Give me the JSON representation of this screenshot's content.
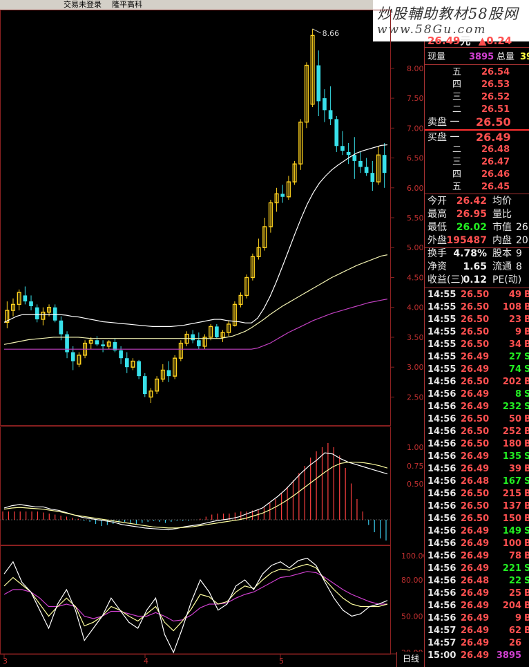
{
  "window": {
    "login_status": "交易未登录",
    "stock_name": "隆平高科"
  },
  "watermark": {
    "line1": "炒股輔助教材58股网",
    "line2": "www.58Gu.com"
  },
  "quote_header": {
    "price": "26.49",
    "unit": "元",
    "change": "▲0.24",
    "extra": "0"
  },
  "volume_row": {
    "now_label": "现量",
    "now_value": "3895",
    "total_label": "总量",
    "total_value": "39"
  },
  "sell_orders": [
    {
      "label": "五",
      "price": "26.54"
    },
    {
      "label": "四",
      "price": "26.53"
    },
    {
      "label": "三",
      "price": "26.52"
    },
    {
      "label": "二",
      "price": "26.51"
    },
    {
      "label": "卖盘 一",
      "price": "26.50"
    }
  ],
  "buy_orders": [
    {
      "label": "买盘 一",
      "price": "26.49"
    },
    {
      "label": "二",
      "price": "26.48"
    },
    {
      "label": "三",
      "price": "26.47"
    },
    {
      "label": "四",
      "price": "26.46"
    },
    {
      "label": "五",
      "price": "26.45"
    }
  ],
  "stats": [
    {
      "l1": "今开",
      "v1": "26.42",
      "c1": "red",
      "l2": "均价",
      "v2": ""
    },
    {
      "l1": "最高",
      "v1": "26.95",
      "c1": "red",
      "l2": "量比",
      "v2": ""
    },
    {
      "l1": "最低",
      "v1": "26.02",
      "c1": "grn",
      "l2": "市值",
      "v2": "26"
    },
    {
      "l1": "外盘",
      "v1": "195487",
      "c1": "red",
      "l2": "内盘",
      "v2": "20"
    },
    {
      "l1": "换手",
      "v1": "4.78%",
      "c1": "white",
      "l2": "股本",
      "v2": "9"
    },
    {
      "l1": "净资",
      "v1": "1.65",
      "c1": "white",
      "l2": "流通",
      "v2": "8"
    },
    {
      "l1": "收益(三)",
      "v1": "0.12",
      "c1": "white",
      "l2": "PE(动)",
      "v2": ""
    }
  ],
  "ticks": [
    {
      "t": "14:55",
      "p": "26.50",
      "v": "49",
      "s": "B"
    },
    {
      "t": "14:55",
      "p": "26.50",
      "v": "108",
      "s": "B"
    },
    {
      "t": "14:55",
      "p": "26.50",
      "v": "23",
      "s": "B"
    },
    {
      "t": "14:55",
      "p": "26.50",
      "v": "9",
      "s": "B"
    },
    {
      "t": "14:55",
      "p": "26.50",
      "v": "34",
      "s": "B"
    },
    {
      "t": "14:55",
      "p": "26.49",
      "v": "27",
      "s": "S"
    },
    {
      "t": "14:55",
      "p": "26.49",
      "v": "74",
      "s": "S"
    },
    {
      "t": "14:56",
      "p": "26.50",
      "v": "202",
      "s": "B"
    },
    {
      "t": "14:56",
      "p": "26.49",
      "v": "8",
      "s": "S"
    },
    {
      "t": "14:56",
      "p": "26.49",
      "v": "232",
      "s": "S"
    },
    {
      "t": "14:56",
      "p": "26.50",
      "v": "50",
      "s": "B"
    },
    {
      "t": "14:56",
      "p": "26.50",
      "v": "252",
      "s": "B"
    },
    {
      "t": "14:56",
      "p": "26.50",
      "v": "180",
      "s": "B"
    },
    {
      "t": "14:56",
      "p": "26.49",
      "v": "135",
      "s": "S"
    },
    {
      "t": "14:56",
      "p": "26.49",
      "v": "39",
      "s": "B"
    },
    {
      "t": "14:56",
      "p": "26.48",
      "v": "167",
      "s": "S"
    },
    {
      "t": "14:56",
      "p": "26.50",
      "v": "215",
      "s": "B"
    },
    {
      "t": "14:56",
      "p": "26.50",
      "v": "137",
      "s": "B"
    },
    {
      "t": "14:56",
      "p": "26.50",
      "v": "150",
      "s": "B"
    },
    {
      "t": "14:56",
      "p": "26.49",
      "v": "149",
      "s": "S"
    },
    {
      "t": "14:56",
      "p": "26.49",
      "v": "100",
      "s": "B"
    },
    {
      "t": "14:56",
      "p": "26.49",
      "v": "78",
      "s": "B"
    },
    {
      "t": "14:56",
      "p": "26.49",
      "v": "221",
      "s": "S"
    },
    {
      "t": "14:56",
      "p": "26.48",
      "v": "22",
      "s": "S"
    },
    {
      "t": "14:56",
      "p": "26.49",
      "v": "25",
      "s": "B"
    },
    {
      "t": "14:56",
      "p": "26.49",
      "v": "204",
      "s": "B"
    },
    {
      "t": "14:56",
      "p": "26.49",
      "v": "9",
      "s": "B"
    },
    {
      "t": "14:57",
      "p": "26.49",
      "v": "62",
      "s": "B"
    },
    {
      "t": "14:57",
      "p": "26.49",
      "v": "26",
      "s": ""
    },
    {
      "t": "15:00",
      "p": "26.49",
      "v": "3895",
      "s": ""
    }
  ],
  "chart": {
    "price_axis": [
      "8.00",
      "7.50",
      "7.00",
      "6.50",
      "6.00",
      "5.50",
      "5.00",
      "4.50",
      "4.00",
      "3.50",
      "3.00",
      "2.50"
    ],
    "macd_axis": [
      "1.00",
      "0.75",
      "0.50"
    ],
    "kdj_axis": [
      "100.00",
      "80.00",
      "50.00",
      "20.00"
    ],
    "high_label": "8.66",
    "x_labels": [
      "3",
      "4",
      "5"
    ],
    "period_tab": "日线",
    "colors": {
      "up": "#ffd21e",
      "down": "#38e0ea",
      "ma_long": "#c040c0",
      "ma_mid": "#f0f0b0",
      "ma_short": "#ffffff"
    }
  },
  "chart_data": {
    "type": "candlestick",
    "ylim": [
      2.1,
      8.75
    ],
    "high": 8.66,
    "candles": [
      {
        "o": 3.75,
        "h": 4.1,
        "l": 3.65,
        "c": 3.95
      },
      {
        "o": 3.95,
        "h": 4.15,
        "l": 3.85,
        "c": 4.05
      },
      {
        "o": 4.05,
        "h": 4.3,
        "l": 3.95,
        "c": 4.25
      },
      {
        "o": 4.2,
        "h": 4.35,
        "l": 4.05,
        "c": 4.1
      },
      {
        "o": 4.1,
        "h": 4.2,
        "l": 3.95,
        "c": 4.02
      },
      {
        "o": 4.0,
        "h": 4.05,
        "l": 3.75,
        "c": 3.8
      },
      {
        "o": 3.8,
        "h": 4.0,
        "l": 3.7,
        "c": 3.92
      },
      {
        "o": 3.92,
        "h": 4.05,
        "l": 3.85,
        "c": 4.0
      },
      {
        "o": 4.0,
        "h": 4.05,
        "l": 3.75,
        "c": 3.78
      },
      {
        "o": 3.78,
        "h": 3.85,
        "l": 3.45,
        "c": 3.55
      },
      {
        "o": 3.55,
        "h": 3.6,
        "l": 3.15,
        "c": 3.25
      },
      {
        "o": 3.25,
        "h": 3.35,
        "l": 2.95,
        "c": 3.1
      },
      {
        "o": 3.05,
        "h": 3.25,
        "l": 3.0,
        "c": 3.2
      },
      {
        "o": 3.2,
        "h": 3.45,
        "l": 3.15,
        "c": 3.4
      },
      {
        "o": 3.4,
        "h": 3.5,
        "l": 3.3,
        "c": 3.45
      },
      {
        "o": 3.45,
        "h": 3.52,
        "l": 3.35,
        "c": 3.38
      },
      {
        "o": 3.38,
        "h": 3.45,
        "l": 3.25,
        "c": 3.35
      },
      {
        "o": 3.35,
        "h": 3.45,
        "l": 3.3,
        "c": 3.42
      },
      {
        "o": 3.42,
        "h": 3.48,
        "l": 3.25,
        "c": 3.28
      },
      {
        "o": 3.28,
        "h": 3.35,
        "l": 3.05,
        "c": 3.15
      },
      {
        "o": 3.15,
        "h": 3.25,
        "l": 2.9,
        "c": 3.0
      },
      {
        "o": 3.0,
        "h": 3.15,
        "l": 2.95,
        "c": 3.1
      },
      {
        "o": 3.1,
        "h": 3.12,
        "l": 2.8,
        "c": 2.85
      },
      {
        "o": 2.85,
        "h": 2.9,
        "l": 2.5,
        "c": 2.55
      },
      {
        "o": 2.5,
        "h": 2.65,
        "l": 2.4,
        "c": 2.6
      },
      {
        "o": 2.6,
        "h": 2.85,
        "l": 2.55,
        "c": 2.8
      },
      {
        "o": 2.8,
        "h": 3.05,
        "l": 2.75,
        "c": 2.95
      },
      {
        "o": 2.95,
        "h": 3.1,
        "l": 2.75,
        "c": 2.85
      },
      {
        "o": 2.85,
        "h": 3.2,
        "l": 2.8,
        "c": 3.15
      },
      {
        "o": 3.15,
        "h": 3.45,
        "l": 3.1,
        "c": 3.4
      },
      {
        "o": 3.4,
        "h": 3.6,
        "l": 3.35,
        "c": 3.55
      },
      {
        "o": 3.55,
        "h": 3.62,
        "l": 3.4,
        "c": 3.45
      },
      {
        "o": 3.45,
        "h": 3.58,
        "l": 3.3,
        "c": 3.35
      },
      {
        "o": 3.35,
        "h": 3.55,
        "l": 3.3,
        "c": 3.5
      },
      {
        "o": 3.5,
        "h": 3.72,
        "l": 3.45,
        "c": 3.68
      },
      {
        "o": 3.68,
        "h": 3.72,
        "l": 3.48,
        "c": 3.5
      },
      {
        "o": 3.5,
        "h": 3.62,
        "l": 3.42,
        "c": 3.58
      },
      {
        "o": 3.58,
        "h": 3.78,
        "l": 3.52,
        "c": 3.72
      },
      {
        "o": 3.7,
        "h": 4.1,
        "l": 3.68,
        "c": 4.05
      },
      {
        "o": 4.05,
        "h": 4.25,
        "l": 4.0,
        "c": 4.2
      },
      {
        "o": 4.2,
        "h": 4.55,
        "l": 4.15,
        "c": 4.5
      },
      {
        "o": 4.5,
        "h": 4.9,
        "l": 4.45,
        "c": 4.85
      },
      {
        "o": 4.85,
        "h": 5.15,
        "l": 4.8,
        "c": 5.0
      },
      {
        "o": 5.0,
        "h": 5.5,
        "l": 4.95,
        "c": 5.35
      },
      {
        "o": 5.35,
        "h": 5.8,
        "l": 5.25,
        "c": 5.75
      },
      {
        "o": 5.75,
        "h": 6.0,
        "l": 5.6,
        "c": 5.9
      },
      {
        "o": 5.9,
        "h": 6.05,
        "l": 5.75,
        "c": 5.85
      },
      {
        "o": 5.85,
        "h": 6.2,
        "l": 5.8,
        "c": 6.1
      },
      {
        "o": 6.1,
        "h": 6.45,
        "l": 6.05,
        "c": 6.4
      },
      {
        "o": 6.4,
        "h": 7.15,
        "l": 6.3,
        "c": 7.1
      },
      {
        "o": 7.1,
        "h": 8.1,
        "l": 7.0,
        "c": 8.05
      },
      {
        "o": 7.4,
        "h": 8.66,
        "l": 7.35,
        "c": 8.55
      },
      {
        "o": 8.05,
        "h": 8.3,
        "l": 7.2,
        "c": 7.45
      },
      {
        "o": 7.5,
        "h": 7.65,
        "l": 7.1,
        "c": 7.3
      },
      {
        "o": 7.3,
        "h": 7.7,
        "l": 7.05,
        "c": 7.15
      },
      {
        "o": 7.15,
        "h": 7.2,
        "l": 6.6,
        "c": 6.7
      },
      {
        "o": 6.7,
        "h": 6.95,
        "l": 6.55,
        "c": 6.62
      },
      {
        "o": 6.6,
        "h": 6.75,
        "l": 6.4,
        "c": 6.55
      },
      {
        "o": 6.55,
        "h": 6.85,
        "l": 6.15,
        "c": 6.45
      },
      {
        "o": 6.45,
        "h": 6.6,
        "l": 6.25,
        "c": 6.35
      },
      {
        "o": 6.35,
        "h": 6.5,
        "l": 6.2,
        "c": 6.25
      },
      {
        "o": 6.25,
        "h": 6.45,
        "l": 5.95,
        "c": 6.1
      },
      {
        "o": 6.1,
        "h": 6.7,
        "l": 6.05,
        "c": 6.55
      },
      {
        "o": 6.55,
        "h": 6.75,
        "l": 6.0,
        "c": 6.25
      }
    ],
    "ma_short": [
      3.75,
      3.8,
      3.85,
      3.88,
      3.88,
      3.88,
      3.88,
      3.88,
      3.88,
      3.88,
      3.87,
      3.85,
      3.84,
      3.82,
      3.8,
      3.78,
      3.76,
      3.75,
      3.74,
      3.73,
      3.72,
      3.71,
      3.7,
      3.69,
      3.68,
      3.68,
      3.68,
      3.68,
      3.69,
      3.7,
      3.72,
      3.74,
      3.76,
      3.78,
      3.8,
      3.8,
      3.78,
      3.77,
      3.76,
      3.74,
      3.74,
      3.82,
      3.98,
      4.18,
      4.42,
      4.68,
      4.95,
      5.22,
      5.48,
      5.72,
      5.92,
      6.08,
      6.2,
      6.3,
      6.38,
      6.45,
      6.52,
      6.58,
      6.62,
      6.65,
      6.68,
      6.71,
      6.72
    ],
    "ma_mid": [
      3.38,
      3.4,
      3.42,
      3.44,
      3.46,
      3.47,
      3.48,
      3.49,
      3.5,
      3.5,
      3.5,
      3.5,
      3.5,
      3.49,
      3.48,
      3.48,
      3.48,
      3.48,
      3.48,
      3.48,
      3.48,
      3.48,
      3.48,
      3.48,
      3.48,
      3.48,
      3.48,
      3.48,
      3.48,
      3.48,
      3.48,
      3.48,
      3.48,
      3.48,
      3.48,
      3.48,
      3.5,
      3.52,
      3.56,
      3.6,
      3.66,
      3.73,
      3.8,
      3.88,
      3.95,
      4.02,
      4.08,
      4.14,
      4.2,
      4.26,
      4.32,
      4.38,
      4.44,
      4.5,
      4.55,
      4.6,
      4.65,
      4.7,
      4.74,
      4.78,
      4.82,
      4.86,
      4.88
    ],
    "ma_long": [
      3.3,
      3.3,
      3.3,
      3.3,
      3.3,
      3.3,
      3.3,
      3.3,
      3.3,
      3.3,
      3.3,
      3.3,
      3.3,
      3.3,
      3.3,
      3.3,
      3.3,
      3.3,
      3.3,
      3.3,
      3.3,
      3.3,
      3.3,
      3.3,
      3.3,
      3.3,
      3.3,
      3.3,
      3.3,
      3.3,
      3.3,
      3.3,
      3.3,
      3.3,
      3.3,
      3.3,
      3.3,
      3.3,
      3.3,
      3.3,
      3.3,
      3.32,
      3.36,
      3.4,
      3.46,
      3.52,
      3.58,
      3.63,
      3.68,
      3.73,
      3.78,
      3.82,
      3.86,
      3.9,
      3.93,
      3.96,
      3.99,
      4.02,
      4.05,
      4.08,
      4.1,
      4.12,
      4.14
    ],
    "macd_hist": [
      0.08,
      0.08,
      0.08,
      0.08,
      0.08,
      0.08,
      0.08,
      0.07,
      0.06,
      0.05,
      0.04,
      0.03,
      0.02,
      0.01,
      -0.01,
      -0.02,
      -0.04,
      -0.06,
      -0.05,
      -0.04,
      -0.03,
      -0.02,
      -0.03,
      -0.04,
      -0.03,
      -0.02,
      -0.01,
      -0.02,
      -0.03,
      -0.02,
      -0.01,
      -0.01,
      -0.01,
      0.0,
      0.01,
      0.03,
      0.05,
      0.06,
      0.06,
      0.06,
      0.07,
      0.08,
      0.08,
      0.09,
      0.1,
      0.12,
      0.16,
      0.2,
      0.26,
      0.32,
      0.38,
      0.45,
      0.52,
      0.6,
      0.66,
      0.7,
      0.74,
      0.7,
      0.62,
      0.5,
      0.35,
      0.2,
      0.08,
      -0.05,
      -0.12,
      -0.18,
      -0.2
    ],
    "macd_dif": [
      0.2,
      0.24,
      0.26,
      0.24,
      0.22,
      0.22,
      0.18,
      0.16,
      0.12,
      0.08,
      0.04,
      0.02,
      0.0,
      -0.02,
      -0.04,
      -0.08,
      -0.1,
      -0.12,
      -0.14,
      -0.15,
      -0.16,
      -0.17,
      -0.15,
      -0.12,
      -0.1,
      -0.08,
      -0.05,
      -0.02,
      0.0,
      0.02,
      0.05,
      0.1,
      0.15,
      0.2,
      0.3,
      0.4,
      0.52,
      0.66,
      0.8,
      0.92,
      1.02,
      1.14,
      1.12,
      1.04,
      0.98,
      0.94,
      0.9,
      0.86,
      0.82,
      0.78
    ],
    "macd_dea": [
      0.18,
      0.2,
      0.21,
      0.2,
      0.19,
      0.18,
      0.16,
      0.14,
      0.11,
      0.08,
      0.06,
      0.04,
      0.02,
      0.0,
      -0.02,
      -0.04,
      -0.06,
      -0.08,
      -0.1,
      -0.12,
      -0.13,
      -0.14,
      -0.14,
      -0.13,
      -0.12,
      -0.1,
      -0.08,
      -0.06,
      -0.04,
      -0.02,
      0.0,
      0.03,
      0.07,
      0.11,
      0.17,
      0.24,
      0.32,
      0.41,
      0.51,
      0.61,
      0.71,
      0.81,
      0.9,
      0.96,
      0.98,
      0.98,
      0.97,
      0.95,
      0.92,
      0.88
    ],
    "kdj_j": [
      85,
      95,
      78,
      70,
      55,
      40,
      60,
      72,
      55,
      30,
      40,
      50,
      65,
      55,
      45,
      40,
      55,
      65,
      35,
      20,
      40,
      62,
      80,
      70,
      55,
      60,
      75,
      80,
      72,
      85,
      92,
      95,
      90,
      96,
      98,
      92,
      78,
      65,
      55,
      50,
      52,
      58,
      60,
      63
    ],
    "kdj_k": [
      75,
      82,
      76,
      70,
      60,
      50,
      58,
      65,
      58,
      42,
      45,
      50,
      58,
      55,
      50,
      46,
      52,
      58,
      45,
      38,
      46,
      56,
      68,
      66,
      60,
      62,
      70,
      75,
      73,
      80,
      86,
      89,
      88,
      91,
      93,
      90,
      80,
      72,
      65,
      60,
      58,
      58,
      58,
      60
    ],
    "kdj_d": [
      68,
      72,
      72,
      70,
      65,
      58,
      58,
      60,
      58,
      50,
      48,
      50,
      54,
      54,
      52,
      50,
      50,
      53,
      50,
      46,
      47,
      51,
      57,
      60,
      60,
      61,
      65,
      68,
      70,
      74,
      78,
      82,
      83,
      85,
      87,
      86,
      82,
      77,
      72,
      68,
      65,
      62,
      60,
      60
    ]
  }
}
